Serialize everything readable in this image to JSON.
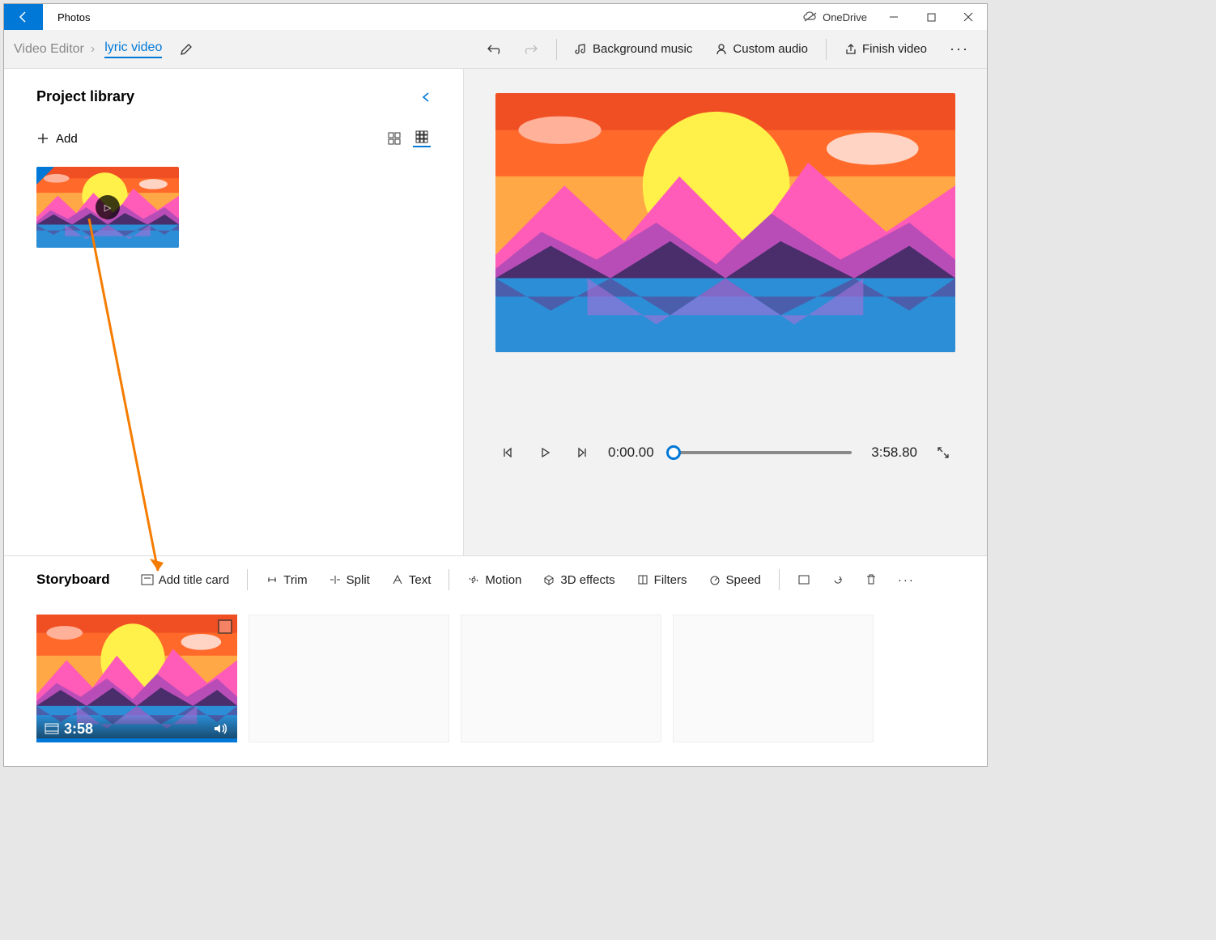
{
  "titlebar": {
    "app": "Photos",
    "cloud": "OneDrive"
  },
  "toolbar": {
    "breadcrumb": "Video Editor",
    "project": "lyric video",
    "bgmusic": "Background music",
    "custom": "Custom audio",
    "finish": "Finish video"
  },
  "library": {
    "title": "Project library",
    "add": "Add"
  },
  "player": {
    "current": "0:00.00",
    "total": "3:58.80"
  },
  "storyboard": {
    "title": "Storyboard",
    "titlecard": "Add title card",
    "trim": "Trim",
    "split": "Split",
    "text": "Text",
    "motion": "Motion",
    "fx3d": "3D effects",
    "filters": "Filters",
    "speed": "Speed",
    "clip_duration": "3:58"
  }
}
